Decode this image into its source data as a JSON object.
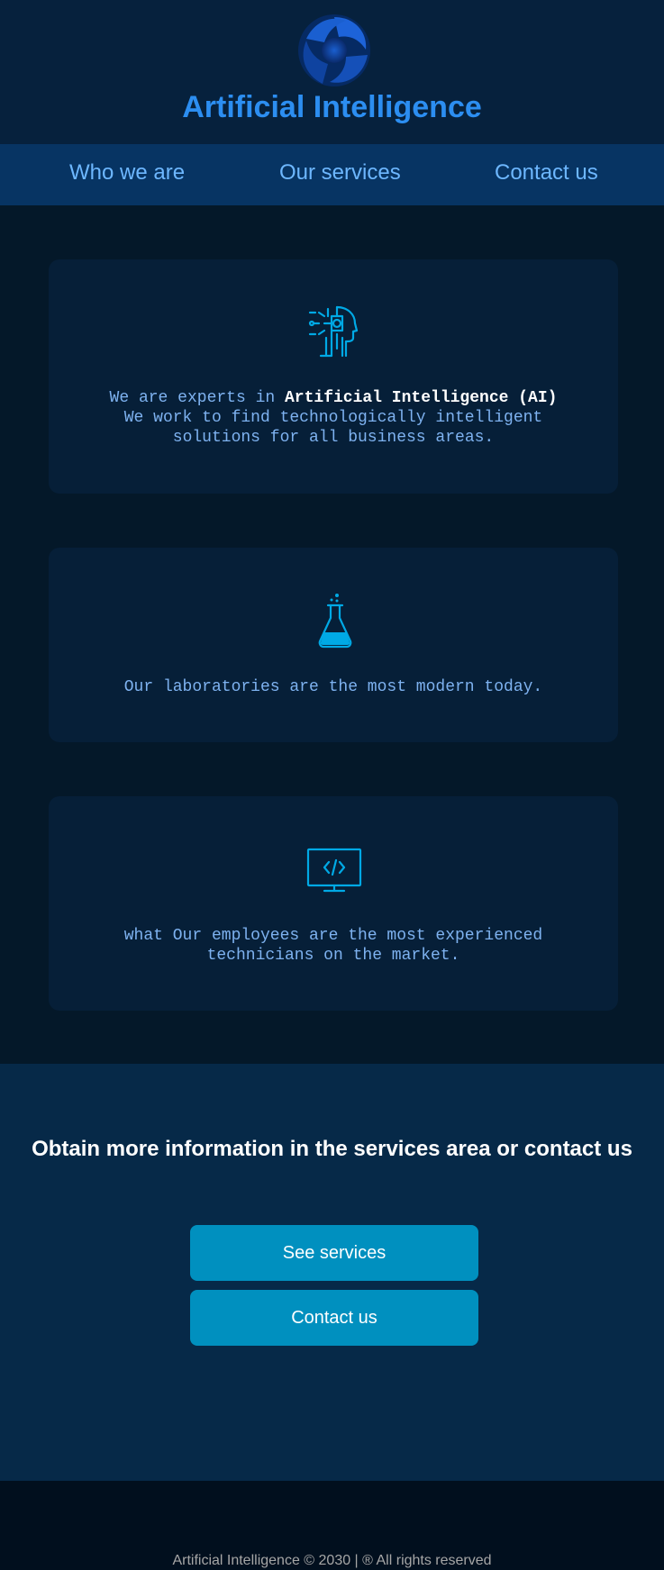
{
  "header": {
    "logo_icon": "swirl-logo-icon",
    "title": "Artificial Intelligence"
  },
  "nav": {
    "items": [
      {
        "label": "Who we are"
      },
      {
        "label": "Our services"
      },
      {
        "label": "Contact us"
      }
    ]
  },
  "cards": [
    {
      "icon": "ai-head-circuit-icon",
      "text_prefix": "We are experts in ",
      "text_bold": "Artificial Intelligence (AI)",
      "text_rest": "We work to find technologically intelligent solutions for all business areas."
    },
    {
      "icon": "lab-flask-icon",
      "text": "Our laboratories are the most modern today."
    },
    {
      "icon": "code-monitor-icon",
      "text": "what Our employees are the most experienced technicians on the market."
    }
  ],
  "cta": {
    "title": "Obtain more information in the services area or contact us",
    "primary_button": "See services",
    "secondary_button": "Contact us"
  },
  "footer": {
    "text": "Artificial Intelligence © 2030 | ® All rights reserved"
  },
  "colors": {
    "accent": "#2c8ef1",
    "nav_bg": "#073463",
    "button_bg": "#0090bf",
    "icon": "#00a9e5"
  }
}
